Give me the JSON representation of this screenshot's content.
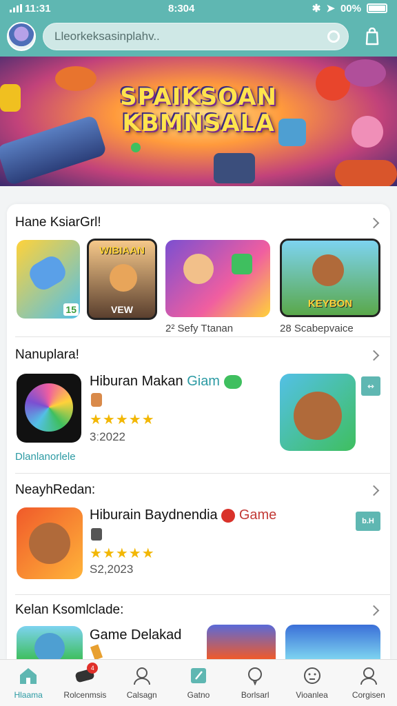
{
  "status_bar": {
    "carrier": "11:31",
    "time": "8:304",
    "battery": "00%"
  },
  "search": {
    "text": "Lleorkeksasinplahv.."
  },
  "banner": {
    "line1": "SPAIKSOAN",
    "line2": "KBMNSALA"
  },
  "sections": [
    {
      "title": "Hane KsiarGrl!",
      "tiles": [
        {
          "badge": "15",
          "caption": ""
        },
        {
          "badge": "WIBIAAN",
          "sub": "VEW",
          "caption": ""
        },
        {
          "caption": "2² Sefy Ttanan"
        },
        {
          "badge": "KEYBON",
          "caption": "28 Scabepvaice"
        }
      ]
    },
    {
      "title": "Nanuplara!",
      "app": {
        "title": "Hiburan Makan",
        "tag": "Giam",
        "date": "3ː2022",
        "link": "Dlanlanorlele"
      }
    },
    {
      "title": "NeayhRedan:",
      "app": {
        "title": "Hiburain Baydnendia",
        "tag": "Game",
        "date": "S2,2023",
        "button": "b.H"
      }
    },
    {
      "title": "Kelan Ksomlclade:",
      "app": {
        "title": "Game Delakad"
      }
    }
  ],
  "bottom_nav": [
    {
      "label": "Hlaama",
      "icon": "home-icon",
      "active": true
    },
    {
      "label": "Rolcenmsis",
      "icon": "gamepad-icon",
      "badge": "4"
    },
    {
      "label": "Calsagn",
      "icon": "user-icon"
    },
    {
      "label": "Gatno",
      "icon": "edit-icon"
    },
    {
      "label": "Borlsarl",
      "icon": "chat-icon"
    },
    {
      "label": "Vioanlea",
      "icon": "face-icon"
    },
    {
      "label": "Corgisen",
      "icon": "profile-icon"
    }
  ],
  "colors": {
    "accent": "#5fb7b2",
    "teal_text": "#2b9aa3",
    "star": "#f2b705"
  }
}
